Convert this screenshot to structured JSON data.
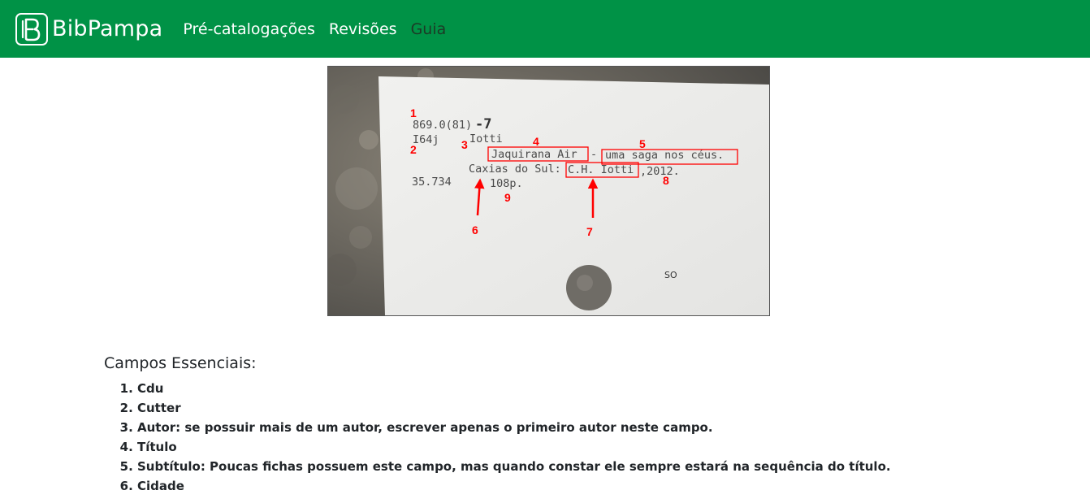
{
  "brand": {
    "name": "BibPampa",
    "logo_icon": "book-b-logo-icon"
  },
  "nav": {
    "items": [
      {
        "label": "Pré-catalogações"
      },
      {
        "label": "Revisões"
      },
      {
        "label": "Guia"
      }
    ]
  },
  "photo": {
    "card_lines": {
      "cdu": "869.0(81)",
      "cdu_hand": "-7",
      "cutter": "I64j",
      "author": "Iotti",
      "title": "Jaquirana Air",
      "dash": "-",
      "subtitle": "uma saga nos céus.",
      "city": "Caxias do Sul:",
      "publisher": "C.H. Iotti",
      "year": ",2012.",
      "number": "35.734",
      "pages": "108p.",
      "stamp": "SO"
    },
    "annotations": {
      "n1": "1",
      "n2": "2",
      "n3": "3",
      "n4": "4",
      "n5": "5",
      "n6": "6",
      "n7": "7",
      "n8": "8",
      "n9": "9"
    },
    "annotation_color": "#ff0000"
  },
  "guide": {
    "title": "Campos Essenciais:",
    "fields": [
      "Cdu",
      "Cutter",
      "Autor: se possuir mais de um autor, escrever apenas o primeiro autor neste campo.",
      "Título",
      "Subtítulo: Poucas fichas possuem este campo, mas quando constar ele sempre estará na sequência do título.",
      "Cidade"
    ]
  },
  "colors": {
    "navbar": "#009246",
    "nav_dim": "#1c3a26"
  }
}
